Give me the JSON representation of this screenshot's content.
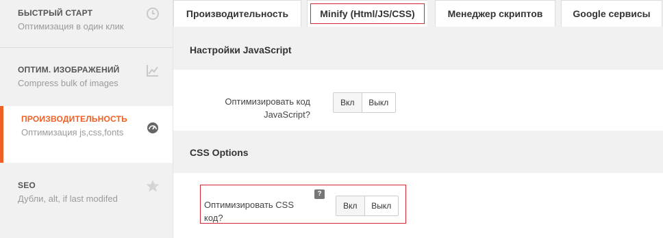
{
  "sidebar": {
    "items": [
      {
        "title": "БЫСТРЫЙ СТАРТ",
        "subtitle": "Оптимизация в один клик",
        "icon": "clock-icon"
      },
      {
        "title": "ОПТИМ. ИЗОБРАЖЕНИЙ",
        "subtitle": "Compress bulk of images",
        "icon": "chart-line-icon"
      },
      {
        "title": "ПРОИЗВОДИТЕЛЬНОСТЬ",
        "subtitle": "Оптимизация js,css,fonts",
        "icon": "speedometer-icon"
      },
      {
        "title": "SEO",
        "subtitle": "Дубли, alt, if last modifed",
        "icon": "star-icon"
      }
    ],
    "active_index": 2,
    "accent_color": "#f05f23"
  },
  "tabs": [
    {
      "label": "Производительность"
    },
    {
      "label": "Minify (Html/JS/CSS)"
    },
    {
      "label": "Менеджер скриптов"
    },
    {
      "label": "Google сервисы"
    }
  ],
  "active_tab": 1,
  "highlight_color": "#d0262f",
  "sections": {
    "js": {
      "heading": "Настройки JavaScript",
      "label_line1": "Оптимизировать код",
      "label_line2": "JavaScript?",
      "toggle_on": "Вкл",
      "toggle_off": "Выкл"
    },
    "css": {
      "heading": "CSS Options",
      "label": "Оптимизировать CSS код?",
      "help": "?",
      "toggle_on": "Вкл",
      "toggle_off": "Выкл"
    }
  }
}
